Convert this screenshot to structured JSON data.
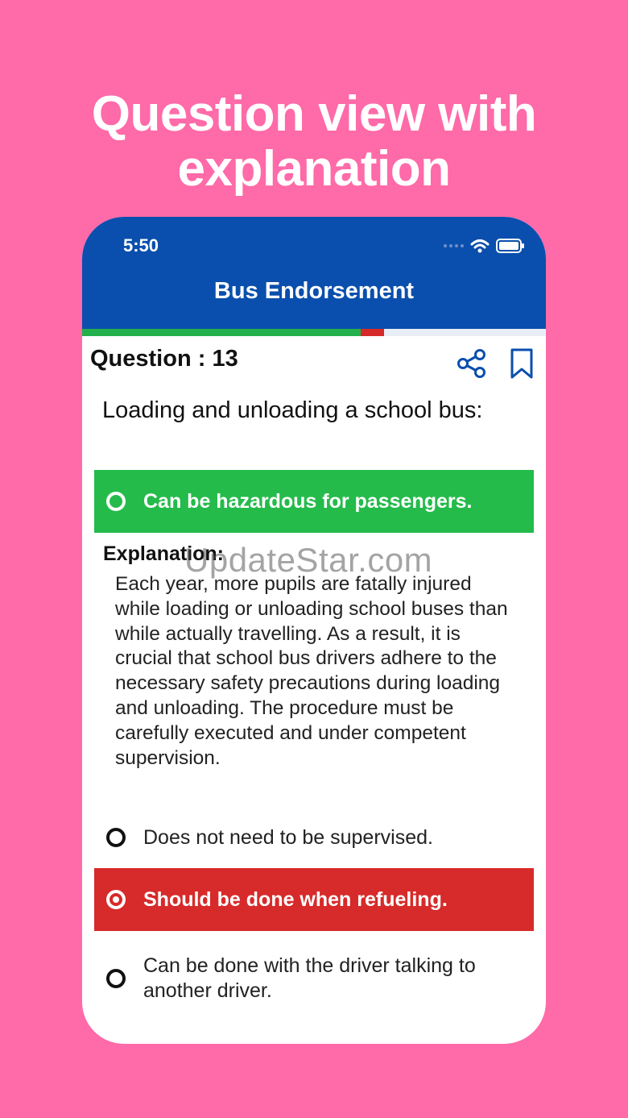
{
  "promo": {
    "title_line1": "Question view with",
    "title_line2": "explanation"
  },
  "status_bar": {
    "time": "5:50"
  },
  "header": {
    "title": "Bus Endorsement"
  },
  "progress": {
    "correct_fraction": 0.6,
    "wrong_fraction": 0.05
  },
  "question": {
    "label": "Question : 13",
    "text": "Loading and unloading a school bus:"
  },
  "options": [
    {
      "label": "Can be hazardous for passengers.",
      "state": "correct"
    },
    {
      "label": "Does not need to be supervised.",
      "state": "unselected"
    },
    {
      "label": "Should be done when refueling.",
      "state": "selected-wrong"
    },
    {
      "label": "Can be done with the driver talking to another driver.",
      "state": "unselected"
    }
  ],
  "explanation": {
    "title": "Explanation:",
    "body": "Each year, more pupils are fatally injured while loading or unloading school buses than while actually travelling. As a result, it is crucial that school bus drivers adhere to the necessary safety precautions during loading and unloading. The procedure must be carefully executed and under competent supervision."
  },
  "watermark": "UpdateStar.com",
  "icons": {
    "share": "share-icon",
    "bookmark": "bookmark-icon",
    "wifi": "wifi-icon",
    "battery": "battery-icon"
  },
  "colors": {
    "header": "#0a4fad",
    "correct": "#24bb4b",
    "wrong": "#d72a2a",
    "background": "#ff6aa8"
  }
}
